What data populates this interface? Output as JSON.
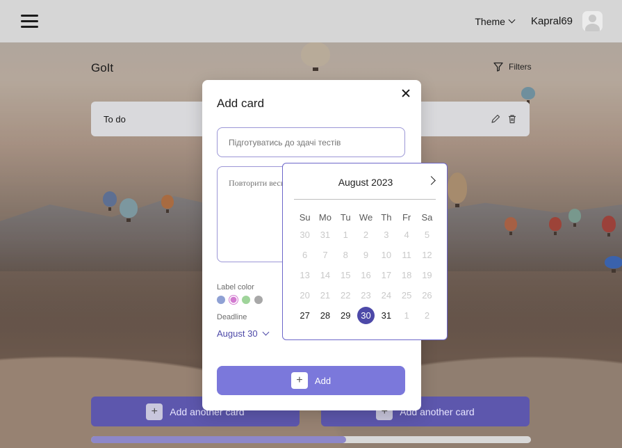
{
  "header": {
    "theme_label": "Theme",
    "username": "Kapral69"
  },
  "board": {
    "title": "GoIt",
    "filters_label": "Filters",
    "columns": [
      {
        "title": "To do"
      },
      {
        "title": ""
      }
    ],
    "add_another_card_label": "Add another card",
    "scroll_progress": 0.58
  },
  "modal": {
    "title": "Add card",
    "title_placeholder": "Підготуватись до здачі тестів",
    "description_placeholder": "Повторити весь матеріал",
    "label_color_title": "Label color",
    "label_colors": [
      "#8fa1d4",
      "#d27bd0",
      "#9fd49a",
      "#a8a8a8"
    ],
    "selected_label_color_index": 1,
    "deadline_title": "Deadline",
    "deadline_value": "August 30",
    "add_button_label": "Add"
  },
  "calendar": {
    "month_label": "August 2023",
    "weekdays": [
      "Su",
      "Mo",
      "Tu",
      "We",
      "Th",
      "Fr",
      "Sa"
    ],
    "days": [
      [
        "30",
        "off"
      ],
      [
        "31",
        "off"
      ],
      [
        "1",
        "off"
      ],
      [
        "2",
        "off"
      ],
      [
        "3",
        "off"
      ],
      [
        "4",
        "off"
      ],
      [
        "5",
        "off"
      ],
      [
        "6",
        "off"
      ],
      [
        "7",
        "off"
      ],
      [
        "8",
        "off"
      ],
      [
        "9",
        "off"
      ],
      [
        "10",
        "off"
      ],
      [
        "11",
        "off"
      ],
      [
        "12",
        "off"
      ],
      [
        "13",
        "off"
      ],
      [
        "14",
        "off"
      ],
      [
        "15",
        "off"
      ],
      [
        "16",
        "off"
      ],
      [
        "17",
        "off"
      ],
      [
        "18",
        "off"
      ],
      [
        "19",
        "off"
      ],
      [
        "20",
        "off"
      ],
      [
        "21",
        "off"
      ],
      [
        "22",
        "off"
      ],
      [
        "23",
        "off"
      ],
      [
        "24",
        "off"
      ],
      [
        "25",
        "off"
      ],
      [
        "26",
        "off"
      ],
      [
        "27",
        "on"
      ],
      [
        "28",
        "on"
      ],
      [
        "29",
        "on"
      ],
      [
        "30",
        "sel"
      ],
      [
        "31",
        "on"
      ],
      [
        "1",
        "off"
      ],
      [
        "2",
        "off"
      ]
    ]
  },
  "icons": {
    "menu": "hamburger-icon",
    "filter": "filter-icon",
    "edit": "pencil-icon",
    "delete": "trash-icon",
    "close": "close-icon",
    "plus": "plus-icon",
    "next": "chevron-right-icon"
  }
}
